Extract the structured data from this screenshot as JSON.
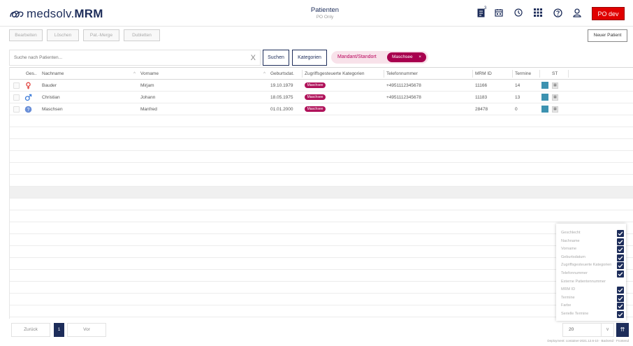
{
  "header": {
    "logo_prefix": "medsolv.",
    "logo_suffix": "MRM",
    "title": "Patienten",
    "subtitle": "PO Only",
    "icons": [
      "document-icon",
      "calendar-icon",
      "clock-icon",
      "grid-icon",
      "help-icon",
      "user-icon"
    ],
    "document_badge": "3",
    "environment_label": "PO dev",
    "environment_color": "#e00000"
  },
  "toolbar": {
    "edit_label": "Bearbeiten",
    "delete_label": "Löschen",
    "merge_label": "Pat.-Merge",
    "duplicates_label": "Dubletten",
    "new_patient_label": "Neuer Patient"
  },
  "search": {
    "placeholder": "Suche nach Patienten...",
    "clear_glyph": "X",
    "search_label": "Suchen",
    "categories_label": "Kategorien",
    "filter_label": "Mandant/Standort",
    "filter_chip": "Maschsee",
    "filter_chip_remove": "×"
  },
  "table": {
    "columns": [
      "Ges..",
      "Nachname",
      "Vorname",
      "Geburtsdat.",
      "Zugriffsgesteuerte Kategorien",
      "Telefonnummer",
      "MRM ID",
      "Termine",
      "ST"
    ],
    "rows": [
      {
        "gender": "female",
        "lastname": "Bauder",
        "firstname": "Mirjam",
        "birthdate": "19.10.1979",
        "category": "Maschsee",
        "phone": "+4951112345678",
        "mrm_id": "11166",
        "appointments": "14"
      },
      {
        "gender": "male",
        "lastname": "Christian",
        "firstname": "Johann",
        "birthdate": "18.05.1975",
        "category": "Maschsee",
        "phone": "+4951112345678",
        "mrm_id": "11183",
        "appointments": "13"
      },
      {
        "gender": "unknown",
        "lastname": "Maschsen",
        "firstname": "Manfred",
        "birthdate": "01.01.2000",
        "category": "Maschsee",
        "phone": "",
        "mrm_id": "28478",
        "appointments": "0"
      }
    ],
    "row_color": "#3c92b0"
  },
  "column_chooser": {
    "items": [
      {
        "label": "Geschlecht",
        "checked": true
      },
      {
        "label": "Nachname",
        "checked": true
      },
      {
        "label": "Vorname",
        "checked": true
      },
      {
        "label": "Geburtsdatum",
        "checked": true
      },
      {
        "label": "Zugriffsgesteuerte Kategorien",
        "checked": true
      },
      {
        "label": "Telefonnummer",
        "checked": true
      },
      {
        "label": "Externe Patientennummer",
        "checked": false
      },
      {
        "label": "MRM ID",
        "checked": true
      },
      {
        "label": "Termine",
        "checked": true
      },
      {
        "label": "Farbe",
        "checked": true
      },
      {
        "label": "Serielle Termine",
        "checked": true
      }
    ]
  },
  "pagination": {
    "prev_label": "Zurück",
    "current_page": "1",
    "next_label": "Vor",
    "page_size": "20",
    "scroll_top_glyph": "⇈"
  },
  "footer": {
    "deployment": "Deployment: container-2021.12.6-10 · Backend · Frontend"
  },
  "colors": {
    "brand": "#1d2d5a",
    "accent": "#a8004e"
  }
}
